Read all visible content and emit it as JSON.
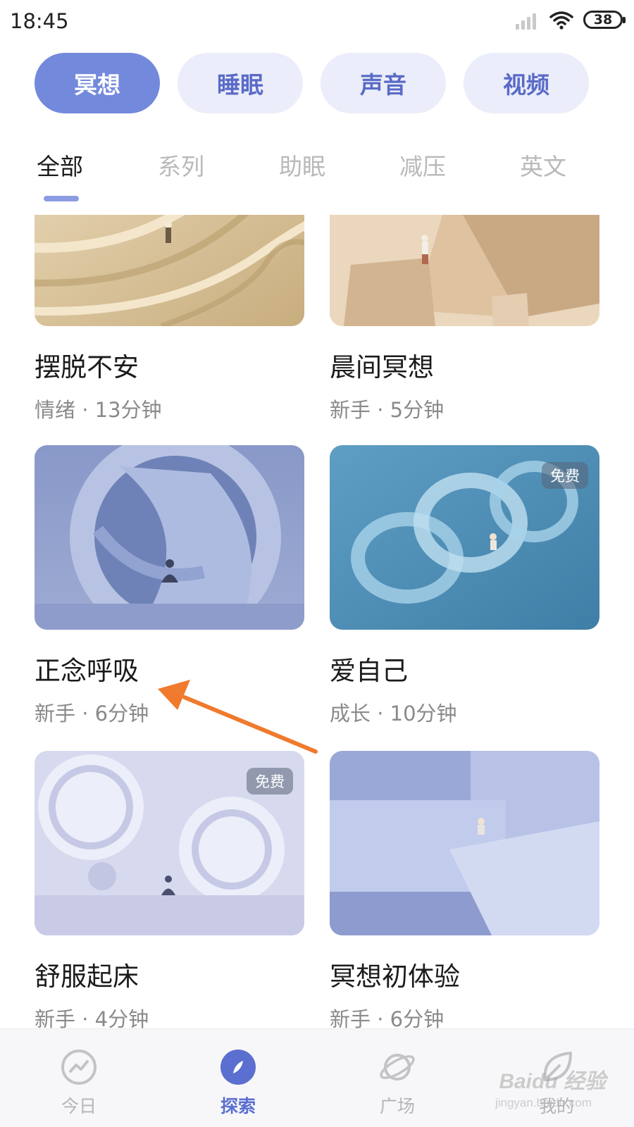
{
  "status_bar": {
    "time": "18:45",
    "battery": "38",
    "icons": [
      "signal-icon",
      "wifi-icon",
      "battery-icon"
    ]
  },
  "category_pills": [
    {
      "label": "冥想",
      "active": true
    },
    {
      "label": "睡眠",
      "active": false
    },
    {
      "label": "声音",
      "active": false
    },
    {
      "label": "视频",
      "active": false
    }
  ],
  "sub_tabs": [
    {
      "label": "全部",
      "active": true
    },
    {
      "label": "系列",
      "active": false
    },
    {
      "label": "助眠",
      "active": false
    },
    {
      "label": "减压",
      "active": false
    },
    {
      "label": "英文",
      "active": false
    }
  ],
  "cards": [
    {
      "title": "摆脱不安",
      "meta": "情绪 · 13分钟",
      "badge": ""
    },
    {
      "title": "晨间冥想",
      "meta": "新手 · 5分钟",
      "badge": ""
    },
    {
      "title": "正念呼吸",
      "meta": "新手 · 6分钟",
      "badge": ""
    },
    {
      "title": "爱自己",
      "meta": "成长 · 10分钟",
      "badge": "免费"
    },
    {
      "title": "舒服起床",
      "meta": "新手 · 4分钟",
      "badge": "免费"
    },
    {
      "title": "冥想初体验",
      "meta": "新手 · 6分钟",
      "badge": ""
    }
  ],
  "bottom_nav": [
    {
      "label": "今日",
      "icon": "trend-icon",
      "active": false
    },
    {
      "label": "探索",
      "icon": "compass-icon",
      "active": true
    },
    {
      "label": "广场",
      "icon": "planet-icon",
      "active": false
    },
    {
      "label": "我的",
      "icon": "leaf-icon",
      "active": false
    }
  ],
  "watermark": {
    "brand": "Baidu 经验",
    "url": "jingyan.baidu.com"
  },
  "colors": {
    "accent": "#7389dc",
    "pill_bg": "#ebedfa",
    "annotation_arrow": "#f07a2e"
  }
}
